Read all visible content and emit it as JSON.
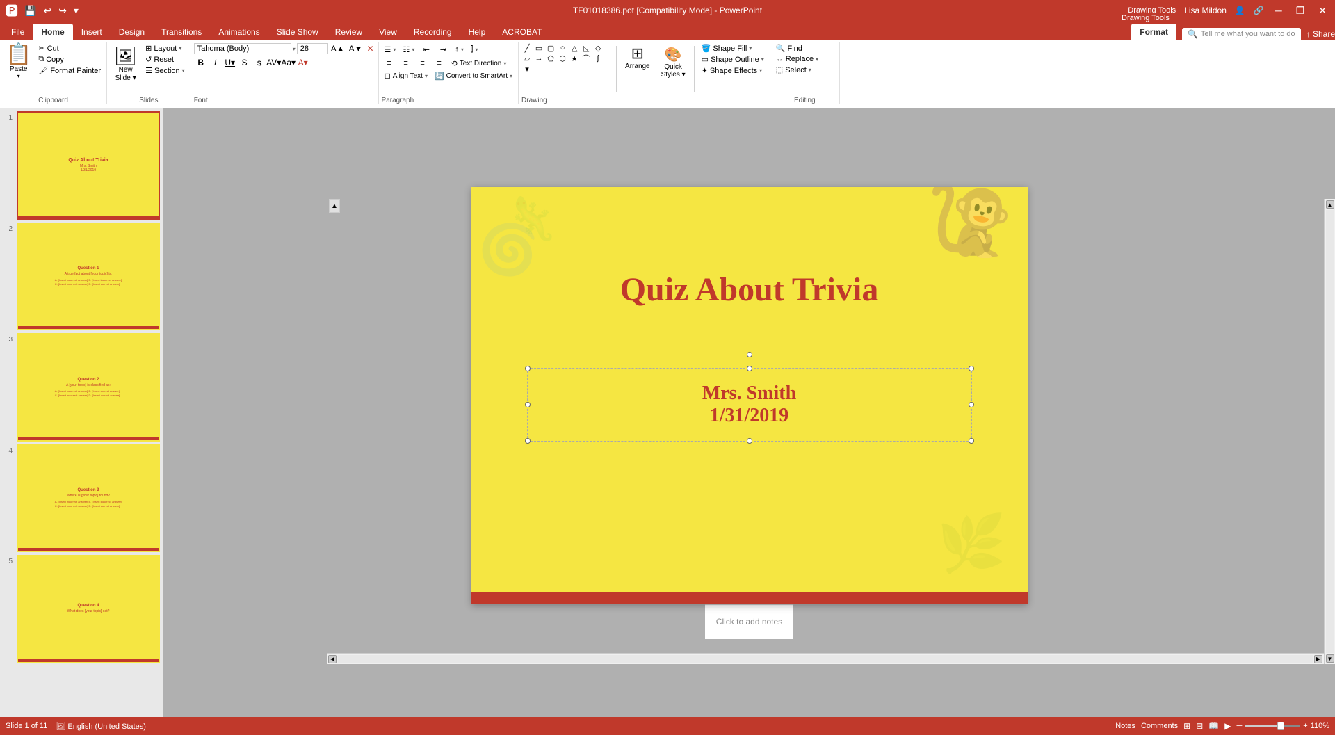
{
  "titlebar": {
    "quick_access": [
      "save",
      "undo",
      "redo",
      "customize"
    ],
    "title": "TF01018386.pot [Compatibility Mode] - PowerPoint",
    "drawing_tools_label": "Drawing Tools",
    "user": "Lisa Mildon",
    "window_buttons": [
      "minimize",
      "restore",
      "close"
    ]
  },
  "ribbon": {
    "tabs": [
      "File",
      "Home",
      "Insert",
      "Design",
      "Transitions",
      "Animations",
      "Slide Show",
      "Review",
      "View",
      "Recording",
      "Help",
      "ACROBAT",
      "Format"
    ],
    "active_tab": "Format",
    "drawing_tools_tab": "Drawing Tools",
    "groups": {
      "clipboard": {
        "label": "Clipboard",
        "paste_label": "Paste",
        "cut_label": "Cut",
        "copy_label": "Copy",
        "format_painter_label": "Format Painter"
      },
      "slides": {
        "label": "Slides",
        "new_slide_label": "New\nSlide",
        "layout_label": "Layout",
        "reset_label": "Reset",
        "section_label": "Section"
      },
      "font": {
        "label": "Font",
        "font_name": "Tahoma (Body)",
        "font_size": "28",
        "bold": "B",
        "italic": "I",
        "underline": "U",
        "strikethrough": "S",
        "shadow": "s",
        "increase_size": "A↑",
        "decrease_size": "A↓",
        "clear_format": "✕",
        "font_color_label": "A"
      },
      "paragraph": {
        "label": "Paragraph",
        "text_direction_label": "Text Direction",
        "align_text_label": "Align Text",
        "convert_smartart_label": "Convert to SmartArt",
        "bullets_label": "Bullets",
        "numbering_label": "Numbering",
        "decrease_indent": "←",
        "increase_indent": "→",
        "line_spacing_label": "Line Spacing",
        "columns_label": "Columns",
        "align_left": "≡",
        "align_center": "≡",
        "align_right": "≡",
        "justify": "≡"
      },
      "drawing": {
        "label": "Drawing",
        "shapes_label": "Shapes",
        "arrange_label": "Arrange",
        "quick_styles_label": "Quick\nStyles",
        "shape_fill_label": "Shape Fill",
        "shape_outline_label": "Shape Outline",
        "shape_effects_label": "Shape Effects"
      },
      "editing": {
        "label": "Editing",
        "find_label": "Find",
        "replace_label": "Replace",
        "select_label": "Select"
      }
    }
  },
  "slides": {
    "current": 1,
    "total": 11,
    "items": [
      {
        "num": 1,
        "title": "Quiz About Trivia",
        "subtitle": "Mrs. Smith",
        "date": "1/31/2019"
      },
      {
        "num": 2,
        "question": "Question 1",
        "body": "A true fact about [your topic] is:",
        "options": [
          "[Insert incorrect answer]",
          "[Insert incorrect answer]",
          "[Insert incorrect answer]",
          "[Insert correct answer]"
        ]
      },
      {
        "num": 3,
        "question": "Question 2",
        "body": "A [your topic] is classified as:",
        "options": [
          "[Insert incorrect answer]",
          "[Insert correct answer]",
          "[Insert incorrect answer]",
          "[Insert correct answer]"
        ]
      },
      {
        "num": 4,
        "question": "Question 3",
        "body": "Where is [your topic] found?",
        "options": [
          "[Insert incorrect answer]",
          "[Insert incorrect answer]",
          "[Insert incorrect answer]",
          "[Insert correct answer]"
        ]
      },
      {
        "num": 5,
        "question": "Question 4",
        "body": "What does [your topic] eat?",
        "options": []
      }
    ]
  },
  "main_slide": {
    "title": "Quiz About Trivia",
    "subtitle_line1": "Mrs. Smith",
    "subtitle_line2": "1/31/2019"
  },
  "status_bar": {
    "slide_info": "Slide 1 of 11",
    "notes_btn": "Notes",
    "comments_btn": "Comments",
    "zoom": "110%",
    "notes_placeholder": "Click to add notes"
  },
  "tell_me": "Tell me what you want to do",
  "search_placeholder": "Tell me what you want to do"
}
